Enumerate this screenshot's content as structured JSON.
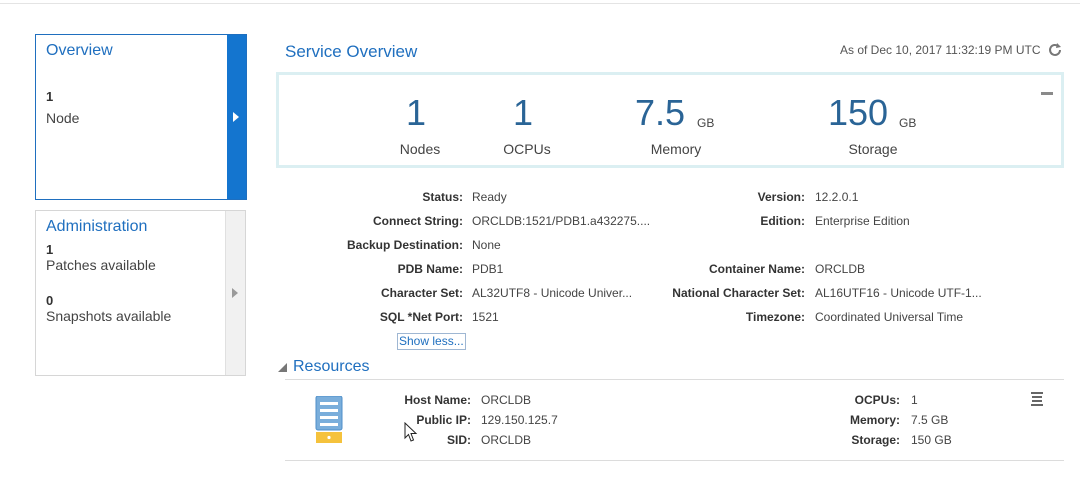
{
  "nav": {
    "overview": {
      "title": "Overview",
      "count": "1",
      "label": "Node"
    },
    "administration": {
      "title": "Administration",
      "patches_count": "1",
      "patches_label": "Patches available",
      "snapshots_count": "0",
      "snapshots_label": "Snapshots available"
    }
  },
  "service": {
    "title": "Service Overview",
    "as_of": "As of Dec 10, 2017 11:32:19 PM UTC"
  },
  "metrics": {
    "nodes": {
      "value": "1",
      "label": "Nodes"
    },
    "ocpus": {
      "value": "1",
      "label": "OCPUs"
    },
    "memory": {
      "value": "7.5",
      "unit": "GB",
      "label": "Memory"
    },
    "storage": {
      "value": "150",
      "unit": "GB",
      "label": "Storage"
    }
  },
  "details": {
    "status": {
      "key": "Status:",
      "value": "Ready"
    },
    "connect": {
      "key": "Connect String:",
      "value": "ORCLDB:1521/PDB1.a432275...."
    },
    "backup": {
      "key": "Backup Destination:",
      "value": "None"
    },
    "pdb": {
      "key": "PDB Name:",
      "value": "PDB1"
    },
    "charset": {
      "key": "Character Set:",
      "value": "AL32UTF8 - Unicode Univer..."
    },
    "sqlnet": {
      "key": "SQL *Net Port:",
      "value": "1521"
    },
    "version": {
      "key": "Version:",
      "value": "12.2.0.1"
    },
    "edition": {
      "key": "Edition:",
      "value": "Enterprise Edition"
    },
    "container": {
      "key": "Container Name:",
      "value": "ORCLDB"
    },
    "ncharset": {
      "key": "National Character Set:",
      "value": "AL16UTF16 - Unicode UTF-1..."
    },
    "timezone": {
      "key": "Timezone:",
      "value": "Coordinated Universal Time"
    },
    "show_less": "Show less..."
  },
  "resources": {
    "title": "Resources",
    "host": {
      "key": "Host Name:",
      "value": "ORCLDB"
    },
    "public_ip": {
      "key": "Public IP:",
      "value": "129.150.125.7"
    },
    "sid": {
      "key": "SID:",
      "value": "ORCLDB"
    },
    "ocpus": {
      "key": "OCPUs:",
      "value": "1"
    },
    "memory": {
      "key": "Memory:",
      "value": "7.5 GB"
    },
    "storage": {
      "key": "Storage:",
      "value": "150 GB"
    }
  },
  "icons": {
    "refresh": "refresh-icon",
    "database": "database-icon",
    "menu": "hamburger-menu-icon",
    "collapse": "minus-icon"
  },
  "colors": {
    "accent": "#1475cf",
    "link": "#1f6fbf",
    "metric": "#2a6496",
    "metric_border": "#dbeff2"
  }
}
